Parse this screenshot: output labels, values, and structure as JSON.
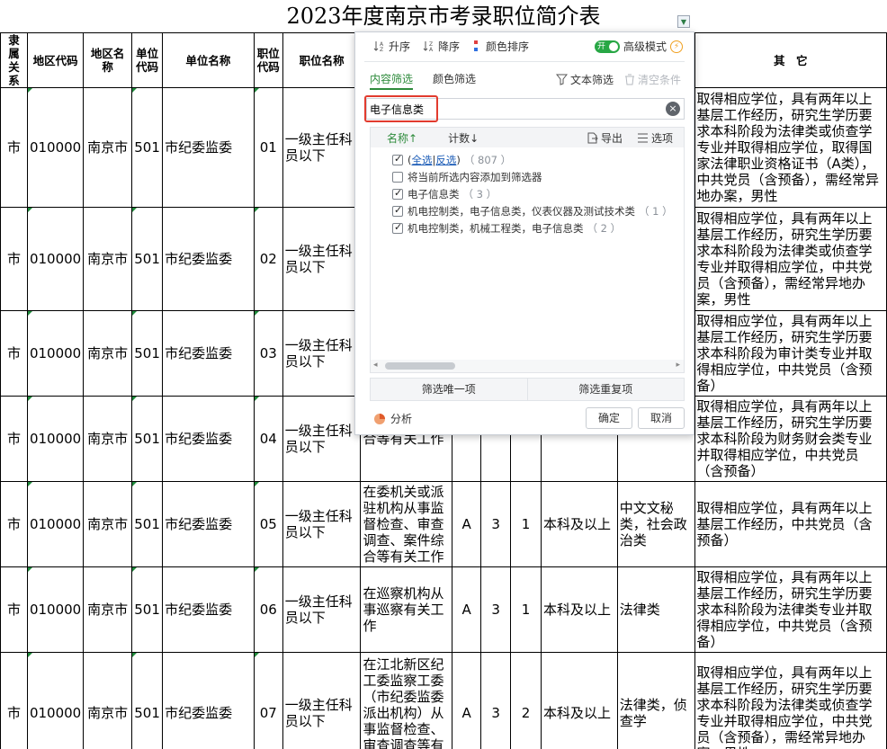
{
  "sheet": {
    "title": "2023年度南京市考录职位简介表",
    "headers": {
      "relation": "隶属关系",
      "region_code": "地区代码",
      "region_name": "地区名称",
      "unit_code": "单位代码",
      "unit_name": "单位名称",
      "position_code": "职位代码",
      "position_name": "职位名称",
      "others": "其　它"
    },
    "rows": [
      {
        "relation": "市",
        "region_code": "010000",
        "region_name": "南京市",
        "unit_code": "501",
        "unit_name": "市纪委监委",
        "position_code": "01",
        "position_name": "一级主任科员以下",
        "duty": "",
        "type": "",
        "count": "",
        "ratio": "",
        "education": "",
        "major": "",
        "note": "取得相应学位，具有两年以上基层工作经历，研究生学历要求本科阶段为法律类或侦查学专业并取得相应学位，取得国家法律职业资格证书（A类），中共党员（含预备），需经常异地办案，男性"
      },
      {
        "relation": "市",
        "region_code": "010000",
        "region_name": "南京市",
        "unit_code": "501",
        "unit_name": "市纪委监委",
        "position_code": "02",
        "position_name": "一级主任科员以下",
        "duty": "",
        "type": "",
        "count": "",
        "ratio": "",
        "education": "",
        "major": "",
        "note": "取得相应学位，具有两年以上基层工作经历，研究生学历要求本科阶段为法律类或侦查学专业并取得相应学位，中共党员（含预备），需经常异地办案，男性"
      },
      {
        "relation": "市",
        "region_code": "010000",
        "region_name": "南京市",
        "unit_code": "501",
        "unit_name": "市纪委监委",
        "position_code": "03",
        "position_name": "一级主任科员以下",
        "duty": "",
        "type": "",
        "count": "",
        "ratio": "",
        "education": "",
        "major": "",
        "note": "取得相应学位，具有两年以上基层工作经历，研究生学历要求本科阶段为审计类专业并取得相应学位，中共党员（含预备）"
      },
      {
        "relation": "市",
        "region_code": "010000",
        "region_name": "南京市",
        "unit_code": "501",
        "unit_name": "市纪委监委",
        "position_code": "04",
        "position_name": "一级主任科员以下",
        "duty": "合等有关工作",
        "type": "",
        "count": "",
        "ratio": "",
        "education": "",
        "major": "",
        "note": "取得相应学位，具有两年以上基层工作经历，研究生学历要求本科阶段为财务财会类专业并取得相应学位，中共党员（含预备）"
      },
      {
        "relation": "市",
        "region_code": "010000",
        "region_name": "南京市",
        "unit_code": "501",
        "unit_name": "市纪委监委",
        "position_code": "05",
        "position_name": "一级主任科员以下",
        "duty": "在委机关或派驻机构从事监督检查、审查调查、案件综合等有关工作",
        "type": "A",
        "count": "3",
        "ratio": "1",
        "education": "本科及以上",
        "major": "中文文秘类，社会政治类",
        "note": "取得相应学位，具有两年以上基层工作经历，中共党员（含预备）"
      },
      {
        "relation": "市",
        "region_code": "010000",
        "region_name": "南京市",
        "unit_code": "501",
        "unit_name": "市纪委监委",
        "position_code": "06",
        "position_name": "一级主任科员以下",
        "duty": "在巡察机构从事巡察有关工作",
        "type": "A",
        "count": "3",
        "ratio": "1",
        "education": "本科及以上",
        "major": "法律类",
        "note": "取得相应学位，具有两年以上基层工作经历，研究生学历要求本科阶段为法律类专业并取得相应学位，中共党员（含预备）"
      },
      {
        "relation": "市",
        "region_code": "010000",
        "region_name": "南京市",
        "unit_code": "501",
        "unit_name": "市纪委监委",
        "position_code": "07",
        "position_name": "一级主任科员以下",
        "duty": "在江北新区纪工委监察工委（市纪委监委派出机构）从事监督检查、审查调查等有关工作",
        "type": "A",
        "count": "3",
        "ratio": "2",
        "education": "本科及以上",
        "major": "法律类，侦查学",
        "note": "取得相应学位，具有两年以上基层工作经历，研究生学历要求本科阶段为法律类或侦查学专业并取得相应学位，中共党员（含预备），需经常异地办案，男性"
      }
    ]
  },
  "filter": {
    "sort_asc": "升序",
    "sort_desc": "降序",
    "sort_color": "颜色排序",
    "toggle_text": "开",
    "advanced": "高级模式",
    "tab_content": "内容筛选",
    "tab_color": "颜色筛选",
    "text_filter": "文本筛选",
    "clear_condition": "清空条件",
    "search_value": "电子信息类",
    "col_name": "名称↑",
    "col_count": "计数↓",
    "export": "导出",
    "options": "选项",
    "items": [
      {
        "pre": "(",
        "link1": "全选",
        "mid": "|",
        "link2": "反选",
        "post": ")",
        "count": "（ 807 ）",
        "checked": true
      },
      {
        "label": "将当前所选内容添加到筛选器",
        "count": "",
        "checked": false
      },
      {
        "label": "电子信息类",
        "count": "（ 3 ）",
        "checked": true
      },
      {
        "label": "机电控制类，电子信息类，仪表仪器及测试技术类",
        "count": "（ 1 ）",
        "checked": true
      },
      {
        "label": "机电控制类，机械工程类，电子信息类",
        "count": "（ 2 ）",
        "checked": true
      }
    ],
    "unique": "筛选唯一项",
    "duplicate": "筛选重复项",
    "analysis": "分析",
    "ok": "确定",
    "cancel": "取消"
  }
}
